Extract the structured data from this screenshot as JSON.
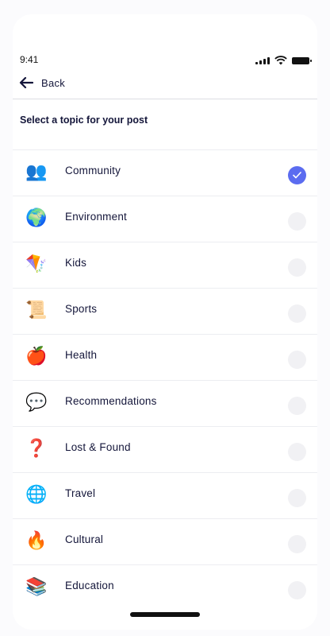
{
  "status": {
    "time": "9:41"
  },
  "nav": {
    "back_label": "Back"
  },
  "heading": "Select a topic for your post",
  "topics": [
    {
      "label": "Community",
      "icon": "community-icon",
      "glyph": "👥",
      "selected": true
    },
    {
      "label": "Environment",
      "icon": "earth-icon",
      "glyph": "🌍",
      "selected": false
    },
    {
      "label": "Kids",
      "icon": "kite-icon",
      "glyph": "🪁",
      "selected": false
    },
    {
      "label": "Sports",
      "icon": "certificate-icon",
      "glyph": "📜",
      "selected": false
    },
    {
      "label": "Health",
      "icon": "fruit-icon",
      "glyph": "🍎",
      "selected": false
    },
    {
      "label": "Recommendations",
      "icon": "heart-bubble-icon",
      "glyph": "💬",
      "selected": false
    },
    {
      "label": "Lost & Found",
      "icon": "lost-found-icon",
      "glyph": "❓",
      "selected": false
    },
    {
      "label": "Travel",
      "icon": "globe-icon",
      "glyph": "🌐",
      "selected": false
    },
    {
      "label": "Cultural",
      "icon": "torch-icon",
      "glyph": "🔥",
      "selected": false
    },
    {
      "label": "Education",
      "icon": "books-icon",
      "glyph": "📚",
      "selected": false
    }
  ],
  "colors": {
    "accent": "#5b6cf0",
    "text": "#14163a",
    "radio_off": "#f1f1f4"
  }
}
